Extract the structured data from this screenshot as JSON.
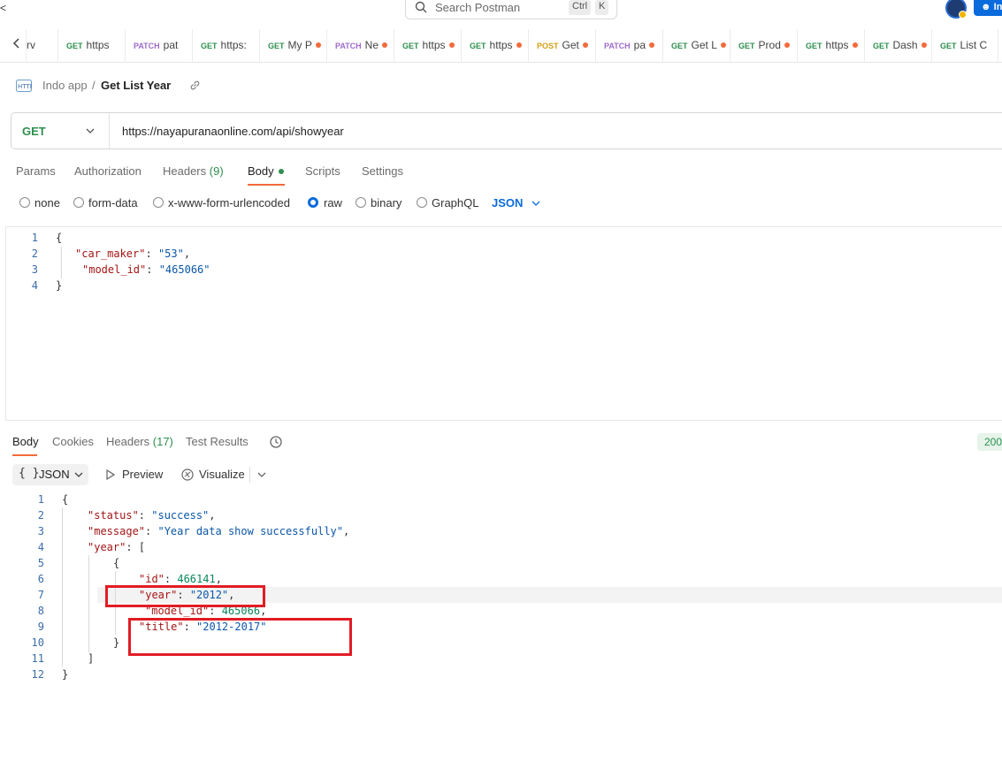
{
  "topbar": {
    "left_edge_text": "<",
    "search_placeholder": "Search Postman",
    "kbd_ctrl": "Ctrl",
    "kbd_k": "K",
    "invite_label": "In"
  },
  "tabs": [
    {
      "method": "",
      "name": "rv",
      "dot": false
    },
    {
      "method": "GET",
      "name": "https",
      "dot": false
    },
    {
      "method": "PATCH",
      "name": "pat",
      "dot": false
    },
    {
      "method": "GET",
      "name": "https:",
      "dot": false
    },
    {
      "method": "GET",
      "name": "My P",
      "dot": true
    },
    {
      "method": "PATCH",
      "name": "Ne",
      "dot": true
    },
    {
      "method": "GET",
      "name": "https",
      "dot": true
    },
    {
      "method": "GET",
      "name": "https",
      "dot": true
    },
    {
      "method": "POST",
      "name": "Get",
      "dot": true
    },
    {
      "method": "PATCH",
      "name": "pa",
      "dot": true
    },
    {
      "method": "GET",
      "name": "Get L",
      "dot": true
    },
    {
      "method": "GET",
      "name": "Prod",
      "dot": true
    },
    {
      "method": "GET",
      "name": "https",
      "dot": true
    },
    {
      "method": "GET",
      "name": "Dash",
      "dot": true
    },
    {
      "method": "GET",
      "name": "List C",
      "dot": true
    }
  ],
  "breadcrumb": {
    "collection": "Indo app",
    "separator": "/",
    "request_name": "Get List Year"
  },
  "request": {
    "method": "GET",
    "url": "https://nayapuranaonline.com/api/showyear"
  },
  "request_tabs": {
    "params": "Params",
    "authorization": "Authorization",
    "headers": "Headers",
    "headers_count": "(9)",
    "body": "Body",
    "scripts": "Scripts",
    "settings": "Settings"
  },
  "body_types": {
    "none": "none",
    "form_data": "form-data",
    "urlencoded": "x-www-form-urlencoded",
    "raw": "raw",
    "binary": "binary",
    "graphql": "GraphQL",
    "format": "JSON",
    "selected": "raw"
  },
  "request_body": {
    "line_numbers": [
      "1",
      "2",
      "3",
      "4"
    ],
    "open_brace": "{",
    "car_maker_key": "\"car_maker\"",
    "car_maker_value": "\"53\"",
    "model_id_key": "\"model_id\"",
    "model_id_value": "\"465066\"",
    "close_brace": "}"
  },
  "response_tabs": {
    "body": "Body",
    "cookies": "Cookies",
    "headers": "Headers",
    "headers_count": "(17)",
    "test_results": "Test Results",
    "status": "200"
  },
  "response_toolbar": {
    "format_icon": "{ }",
    "format": "JSON",
    "preview": "Preview",
    "visualize": "Visualize"
  },
  "response_body": {
    "line_numbers": [
      "1",
      "2",
      "3",
      "4",
      "5",
      "6",
      "7",
      "8",
      "9",
      "10",
      "11",
      "12"
    ],
    "open_brace": "{",
    "status_key": "\"status\"",
    "status_value": "\"success\"",
    "message_key": "\"message\"",
    "message_value": "\"Year data show successfully\"",
    "year_key": "\"year\"",
    "array_open": "[",
    "obj_open": "{",
    "id_key": "\"id\"",
    "id_value": "466141",
    "year_item_key": "\"year\"",
    "year_item_value": "\"2012\"",
    "model_id_key": "\"model_id\"",
    "model_id_value": "465066",
    "title_key": "\"title\"",
    "title_value": "\"2012-2017\"",
    "obj_close": "}",
    "array_close": "]",
    "close_brace": "}"
  },
  "colors": {
    "accent_orange": "#f26b3a",
    "get_green": "#2d8f4e",
    "patch_purple": "#9e6cc9",
    "post_yellow": "#d4a017",
    "link_blue": "#0a6bdc",
    "annotation_red": "#e21c24"
  },
  "icons": [
    "search-icon",
    "back-chevron-icon",
    "http-icon",
    "link-icon",
    "chevron-down-icon",
    "history-icon",
    "play-icon",
    "visualize-icon",
    "avatar-icon",
    "add-user-icon"
  ]
}
